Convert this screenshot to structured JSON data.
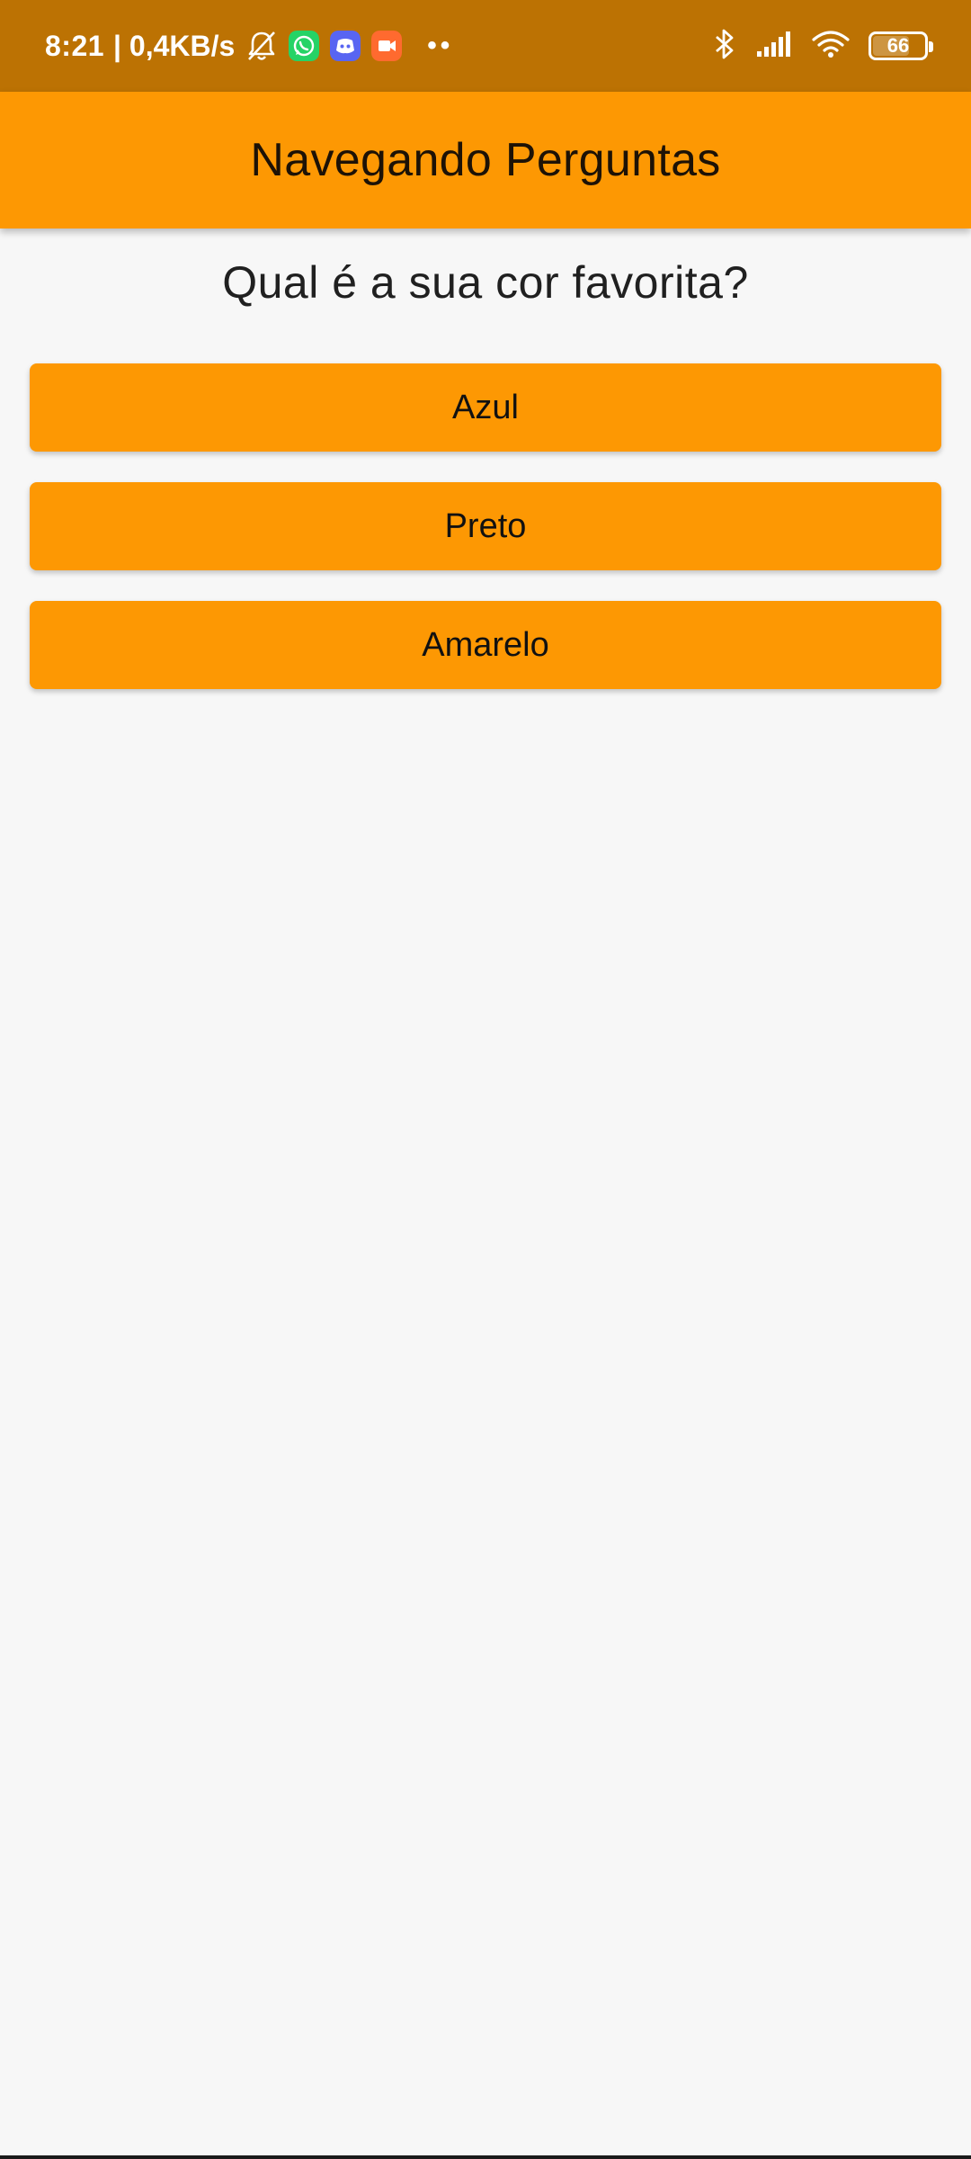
{
  "status_bar": {
    "time": "8:21",
    "speed": "| 0,4KB/s",
    "dots": "••",
    "battery": "66",
    "battery_level_percent": 66,
    "icons": [
      "bell-off-icon",
      "whatsapp-icon",
      "discord-icon",
      "screen-recorder-icon",
      "bluetooth-icon",
      "signal-icon",
      "wifi-icon",
      "battery-icon"
    ],
    "colors": {
      "whatsapp": "#25d366",
      "discord": "#5865f2",
      "recorder": "#ff6a2f"
    }
  },
  "appbar": {
    "title": "Navegando Perguntas",
    "color": "#fd9803"
  },
  "question": {
    "text": "Qual é a sua cor favorita?"
  },
  "answers": [
    {
      "label": "Azul"
    },
    {
      "label": "Preto"
    },
    {
      "label": "Amarelo"
    }
  ],
  "colors": {
    "status_bar": "#bc7203",
    "background": "#f7f7f7",
    "button": "#fd9803"
  }
}
